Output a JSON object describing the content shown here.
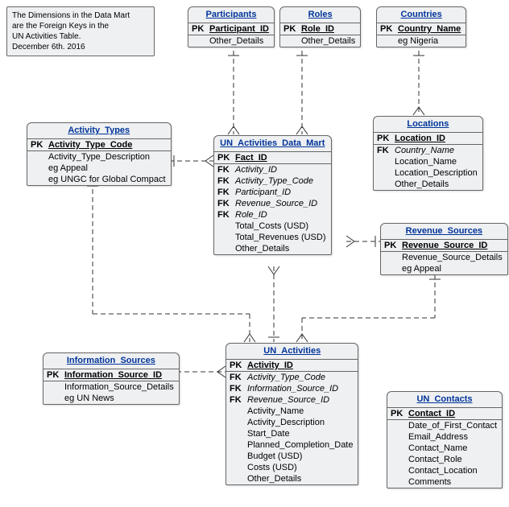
{
  "note": {
    "line1": "The Dimensions in the Data Mart",
    "line2": "are the Foreign Keys in the",
    "line3": "UN Activities Table.",
    "line4": "December 6th. 2016"
  },
  "entities": {
    "participants": {
      "title": "Participants",
      "pk_key": "PK",
      "pk": "Participant_ID",
      "a1": "Other_Details"
    },
    "roles": {
      "title": "Roles",
      "pk_key": "PK",
      "pk": "Role_ID",
      "a1": "Other_Details"
    },
    "countries": {
      "title": "Countries",
      "pk_key": "PK",
      "pk": "Country_Name",
      "a1": "eg Nigeria"
    },
    "activity_types": {
      "title": "Activity_Types",
      "pk_key": "PK",
      "pk": "Activity_Type_Code",
      "a1": "Activity_Type_Description",
      "a2": "eg Appeal",
      "a3": "eg UNGC for Global Compact"
    },
    "data_mart": {
      "title": "UN_Activities_Data_Mart",
      "pk_key": "PK",
      "pk": "Fact_ID",
      "fk1_key": "FK",
      "fk1": "Activity_ID",
      "fk2_key": "FK",
      "fk2": "Activity_Type_Code",
      "fk3_key": "FK",
      "fk3": "Participant_ID",
      "fk4_key": "FK",
      "fk4": "Revenue_Source_ID",
      "fk5_key": "FK",
      "fk5": "Role_ID",
      "a1": "Total_Costs (USD)",
      "a2": "Total_Revenues (USD)",
      "a3": "Other_Details"
    },
    "locations": {
      "title": "Locations",
      "pk_key": "PK",
      "pk": "Location_ID",
      "fk1_key": "FK",
      "fk1": "Country_Name",
      "a1": "Location_Name",
      "a2": "Location_Description",
      "a3": "Other_Details"
    },
    "revenue_sources": {
      "title": "Revenue_Sources",
      "pk_key": "PK",
      "pk": "Revenue_Source_ID",
      "a1": "Revenue_Source_Details",
      "a2": "eg Appeal"
    },
    "information_sources": {
      "title": "Information_Sources",
      "pk_key": "PK",
      "pk": "Information_Source_ID",
      "a1": "Information_Source_Details",
      "a2": "eg UN News"
    },
    "un_activities": {
      "title": "UN_Activities",
      "pk_key": "PK",
      "pk": "Activity_ID",
      "fk1_key": "FK",
      "fk1": "Activity_Type_Code",
      "fk2_key": "FK",
      "fk2": "Information_Source_ID",
      "fk3_key": "FK",
      "fk3": "Revenue_Source_ID",
      "a1": "Activity_Name",
      "a2": "Activity_Description",
      "a3": "Start_Date",
      "a4": "Planned_Completion_Date",
      "a5": "Budget (USD)",
      "a6": "Costs (USD)",
      "a7": "Other_Details"
    },
    "un_contacts": {
      "title": "UN_Contacts",
      "pk_key": "PK",
      "pk": "Contact_ID",
      "a1": "Date_of_First_Contact",
      "a2": "Email_Address",
      "a3": "Contact_Name",
      "a4": "Contact_Role",
      "a5": "Contact_Location",
      "a6": "Comments"
    }
  }
}
